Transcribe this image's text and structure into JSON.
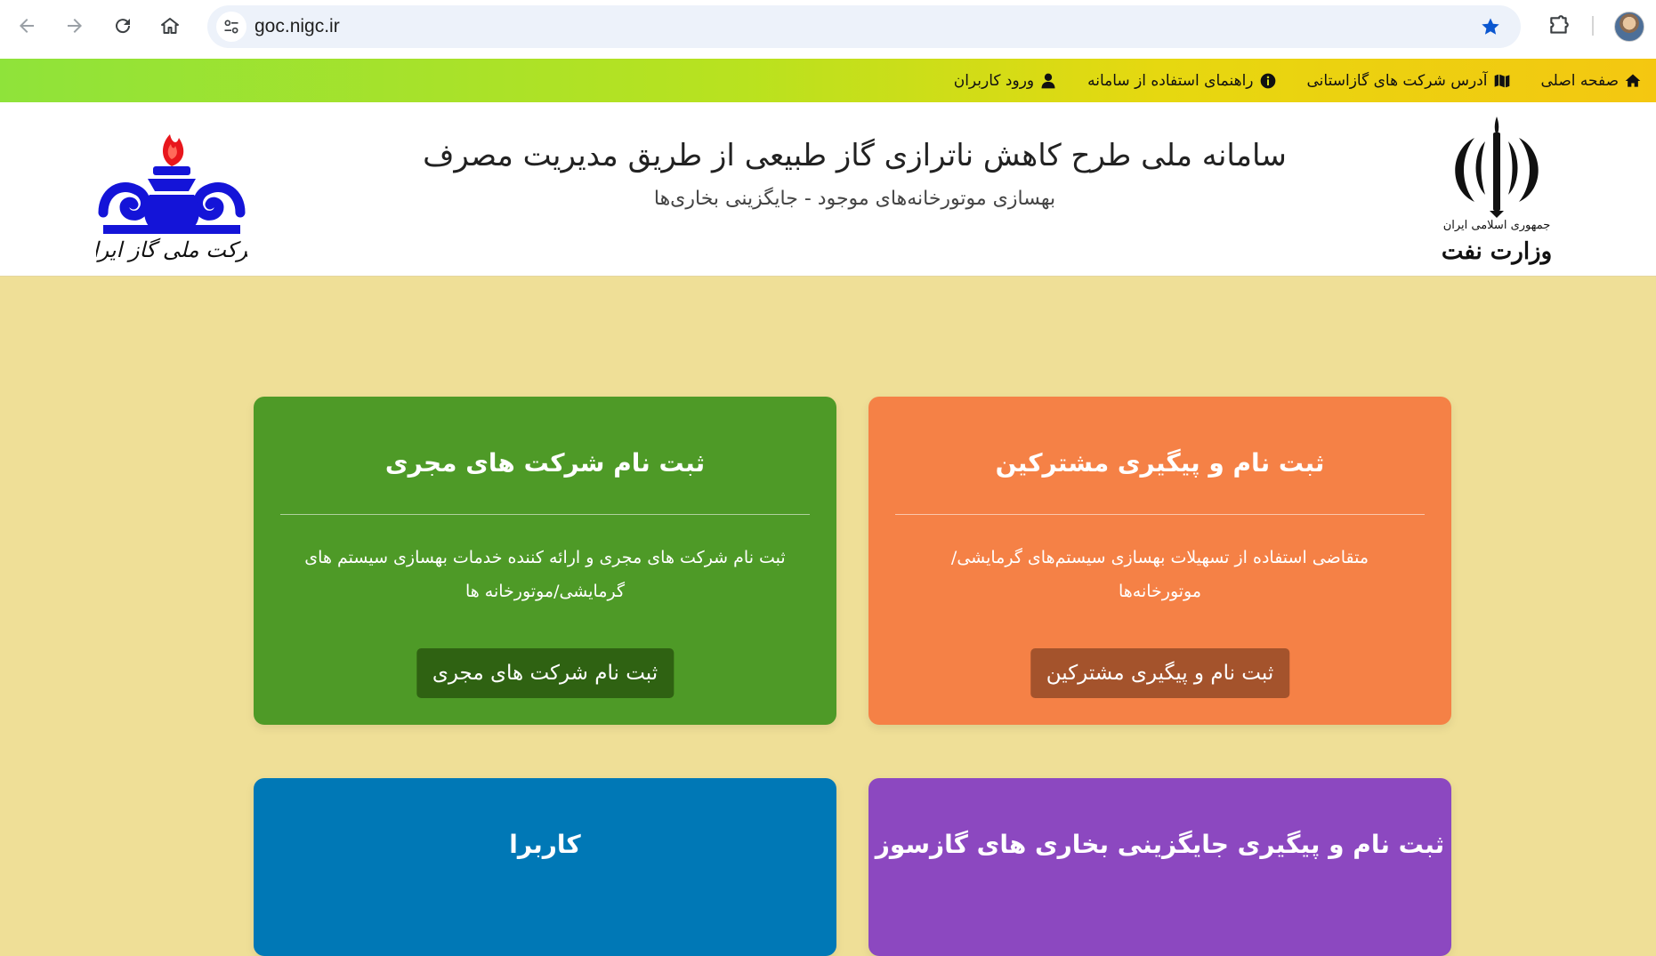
{
  "browser": {
    "url": "goc.nigc.ir"
  },
  "topnav": {
    "items": [
      {
        "label": "صفحه اصلی",
        "icon": "home-icon"
      },
      {
        "label": "آدرس شرکت های گازاستانی",
        "icon": "map-icon"
      },
      {
        "label": "راهنمای استفاده از سامانه",
        "icon": "info-icon"
      },
      {
        "label": "ورود کاربران",
        "icon": "user-icon"
      }
    ]
  },
  "header": {
    "title": "سامانه ملی طرح کاهش ناترازی گاز طبیعی از طریق مدیریت مصرف",
    "subtitle": "بهسازی موتورخانه‌های موجود - جایگزینی بخاری‌ها",
    "left_logo_text": "شرکت ملی گاز ایران",
    "right_logo_text_line1": "جمهوری اسلامی ایران",
    "right_logo_text_line2": "وزارت نفت"
  },
  "cards": [
    {
      "title": "ثبت نام و پیگیری مشترکین",
      "desc": "متقاضی استفاده از تسهیلات بهسازی سیستم‌های گرمایشی/موتورخانه‌ها",
      "button": "ثبت نام و پیگیری مشترکین",
      "color": "#f58146",
      "button_color": "#a4532c"
    },
    {
      "title": "ثبت نام شرکت های مجری",
      "desc": "ثبت نام شرکت های مجری و ارائه کننده خدمات بهسازی سیستم های گرمایشی/موتورخانه ها",
      "button": "ثبت نام شرکت های مجری",
      "color": "#4e9a27",
      "button_color": "#2f6212"
    },
    {
      "title": "ثبت نام و پیگیری جایگزینی بخاری های گازسوز",
      "color": "#8c48c0"
    },
    {
      "title": "کاربرا",
      "color": "#0078b6"
    }
  ],
  "colors": {
    "page_bg": "#efdf97",
    "accent_star": "#0b57d0"
  }
}
